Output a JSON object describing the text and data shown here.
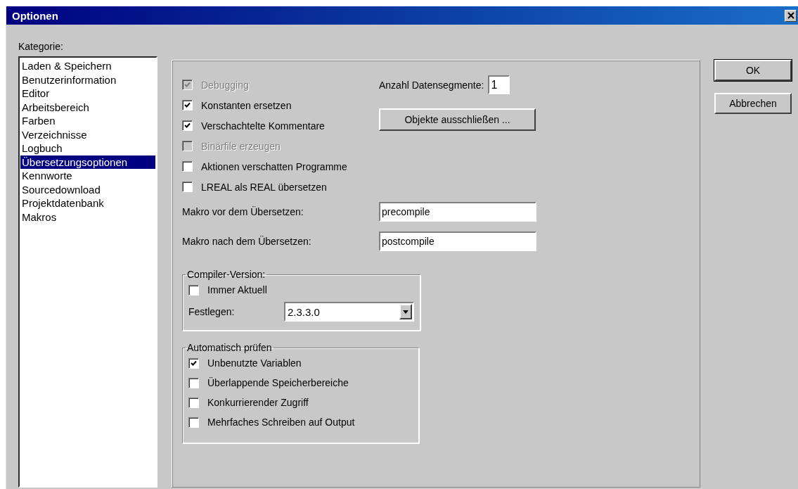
{
  "window": {
    "title": "Optionen"
  },
  "category_label": "Kategorie:",
  "categories": [
    {
      "label": "Laden & Speichern",
      "selected": false
    },
    {
      "label": "Benutzerinformation",
      "selected": false
    },
    {
      "label": "Editor",
      "selected": false
    },
    {
      "label": "Arbeitsbereich",
      "selected": false
    },
    {
      "label": "Farben",
      "selected": false
    },
    {
      "label": "Verzeichnisse",
      "selected": false
    },
    {
      "label": "Logbuch",
      "selected": false
    },
    {
      "label": "Übersetzungsoptionen",
      "selected": true
    },
    {
      "label": "Kennworte",
      "selected": false
    },
    {
      "label": "Sourcedownload",
      "selected": false
    },
    {
      "label": "Projektdatenbank",
      "selected": false
    },
    {
      "label": "Makros",
      "selected": false
    }
  ],
  "options": [
    {
      "label": "Debugging",
      "checked": true,
      "disabled": true
    },
    {
      "label": "Konstanten ersetzen",
      "checked": true,
      "disabled": false
    },
    {
      "label": "Verschachtelte Kommentare",
      "checked": true,
      "disabled": false
    },
    {
      "label": "Binärfile erzeugen",
      "checked": false,
      "disabled": true
    },
    {
      "label": "Aktionen verschatten Programme",
      "checked": false,
      "disabled": false
    },
    {
      "label": "LREAL als REAL übersetzen",
      "checked": false,
      "disabled": false
    }
  ],
  "data_segments": {
    "label": "Anzahl Datensegmente:",
    "value": "1"
  },
  "exclude_button": "Objekte ausschließen ...",
  "macros": [
    {
      "label": "Makro vor dem Übersetzen:",
      "value": "precompile"
    },
    {
      "label": "Makro nach dem Übersetzen:",
      "value": "postcompile"
    }
  ],
  "compiler_version": {
    "title": "Compiler-Version:",
    "options": [
      {
        "label": "Immer Aktuell",
        "checked": false,
        "disabled": false
      }
    ],
    "fixed_label": "Festlegen:",
    "fixed_value": "2.3.3.0"
  },
  "auto_check": {
    "title": "Automatisch prüfen",
    "options": [
      {
        "label": "Unbenutzte Variablen",
        "checked": true,
        "disabled": false
      },
      {
        "label": "Überlappende Speicherbereiche",
        "checked": false,
        "disabled": false
      },
      {
        "label": "Konkurrierender Zugriff",
        "checked": false,
        "disabled": false
      },
      {
        "label": "Mehrfaches Schreiben auf Output",
        "checked": false,
        "disabled": false
      }
    ]
  },
  "buttons": [
    {
      "label": "OK",
      "default": true
    },
    {
      "label": "Abbrechen",
      "default": false
    }
  ]
}
